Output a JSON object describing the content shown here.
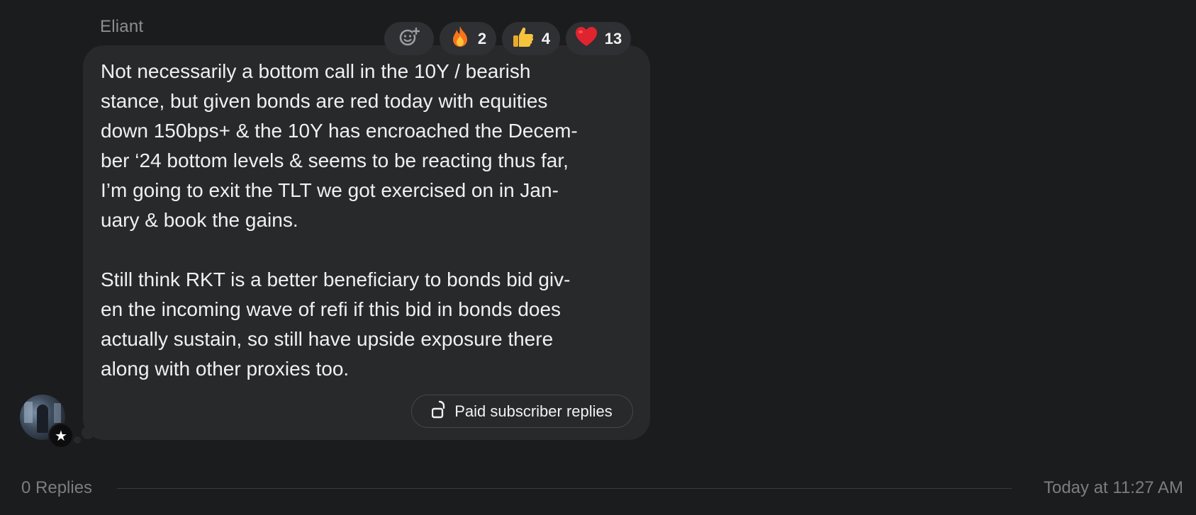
{
  "message": {
    "author": "Eliant",
    "paragraphs": [
      "Not necessarily a bottom call in the 10Y / bearish\nstance, but given bonds are red today with equities\ndown 150bps+ & the 10Y has encroached the Decem-\nber ‘24 bottom levels & seems to be reacting thus far,\nI’m going to exit the TLT we got exercised on in Jan-\nuary & book the gains.",
      "Still think RKT is a better beneficiary to bonds bid giv-\nen the incoming wave of refi if this bid in bonds does\nactually sustain, so still have upside exposure there\nalong with other proxies too."
    ],
    "reactions": [
      {
        "icon": "fire-emoji",
        "emoji": "🔥",
        "count": "2"
      },
      {
        "icon": "thumbs-up-emoji",
        "emoji": "👍",
        "count": "4"
      },
      {
        "icon": "heart-emoji",
        "emoji": "❤",
        "count": "13"
      }
    ],
    "add_reaction_icon": "add-reaction-icon",
    "paid_replies_label": "Paid subscriber replies",
    "paid_replies_icon": "unlocked-padlock-icon",
    "badge_icon": "star-icon"
  },
  "footer": {
    "replies": "0 Replies",
    "timestamp": "Today at 11:27 AM"
  },
  "colors": {
    "background": "#1b1c1e",
    "bubble": "#27292b",
    "heart": "#e0242f",
    "fire": "#f5741c",
    "thumbs": "#f6c33d"
  }
}
